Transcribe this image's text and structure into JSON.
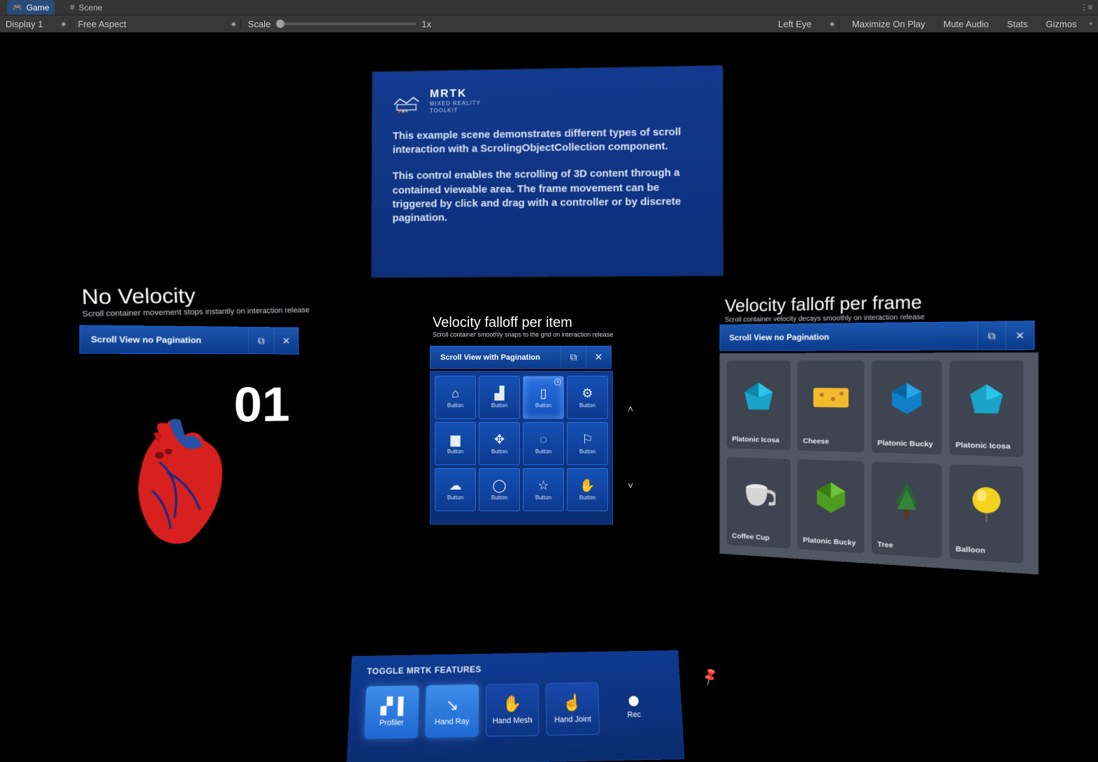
{
  "tabs": {
    "game": "Game",
    "scene": "Scene"
  },
  "toolbar": {
    "display": "Display 1",
    "aspect": "Free Aspect",
    "scaleLabel": "Scale",
    "scaleValue": "1x",
    "eye": "Left Eye",
    "maximize": "Maximize On Play",
    "mute": "Mute Audio",
    "stats": "Stats",
    "gizmos": "Gizmos"
  },
  "desc": {
    "logoTitle": "MRTK",
    "logoSub1": "MIXED REALITY",
    "logoSub2": "TOOLKIT",
    "p1": "This example scene demonstrates different types of scroll interaction with a ScrolingObjectCollection component.",
    "p2": "This control enables the scrolling of 3D content through a contained viewable area. The frame movement can be triggered by click and drag with a controller or by discrete pagination."
  },
  "sections": {
    "left": {
      "title": "No Velocity",
      "sub": "Scroll container movement stops instantly on interaction release"
    },
    "center": {
      "title": "Velocity falloff per item",
      "sub": "Scroll container smoothly snaps to the grid on interaction release"
    },
    "right": {
      "title": "Velocity falloff per frame",
      "sub": "Scroll container velocity decays smoothly on interaction release"
    }
  },
  "winbars": {
    "left": "Scroll View no Pagination",
    "center": "Scroll View with Pagination",
    "right": "Scroll View no Pagination"
  },
  "number": "01",
  "buttonGrid": {
    "label": "Button"
  },
  "cards": [
    "Platonic Icosa",
    "Cheese",
    "Platonic Bucky",
    "Platonic Icosa",
    "Coffee Cup",
    "Platonic Bucky",
    "Tree",
    "Balloon"
  ],
  "toggles": {
    "title": "TOGGLE MRTK FEATURES",
    "items": [
      "Profiler",
      "Hand Ray",
      "Hand Mesh",
      "Hand Joint"
    ],
    "rec": "Rec"
  }
}
